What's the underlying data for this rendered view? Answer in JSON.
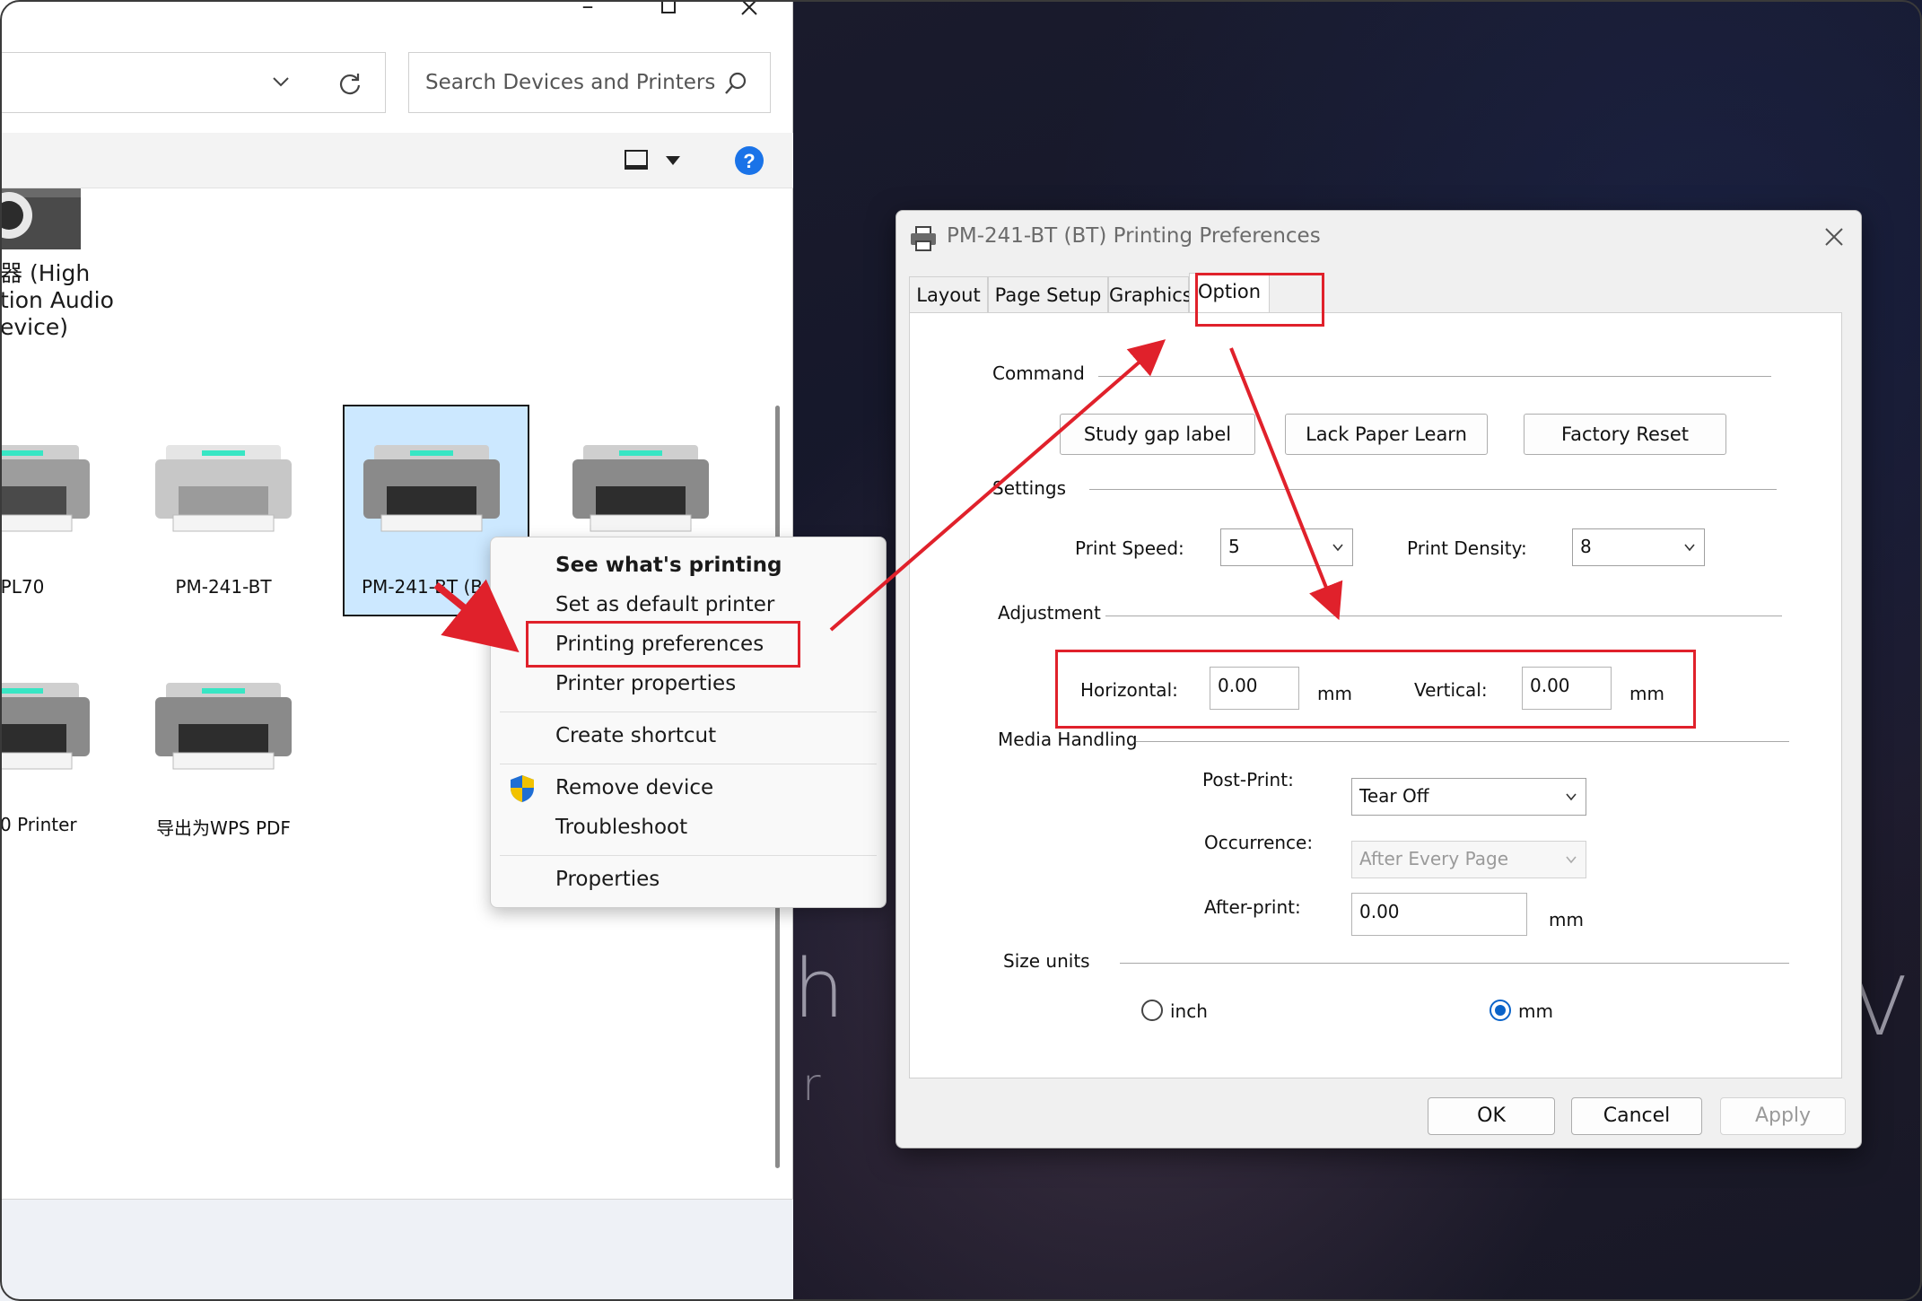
{
  "explorer": {
    "search_placeholder": "Search Devices and Printers",
    "devices_top": {
      "audio_label_line1": "器 (High",
      "audio_label_line2": "tion Audio",
      "audio_label_line3": "evice)"
    },
    "printers_row1": [
      "PL70",
      "PM-241-BT",
      "PM-241-BT (B",
      ""
    ],
    "printers_row2": [
      "0 Printer",
      "导出为WPS PDF"
    ]
  },
  "context_menu": {
    "items": [
      "See what's printing",
      "Set as default printer",
      "Printing preferences",
      "Printer properties",
      "Create shortcut",
      "Remove device",
      "Troubleshoot",
      "Properties"
    ]
  },
  "dialog": {
    "title": "PM-241-BT (BT) Printing Preferences",
    "tabs": [
      "Layout",
      "Page Setup",
      "Graphics",
      "Option"
    ],
    "active_tab": "Option",
    "command": {
      "label": "Command",
      "buttons": [
        "Study gap label",
        "Lack Paper Learn",
        "Factory Reset"
      ]
    },
    "settings": {
      "label": "Settings",
      "print_speed_label": "Print Speed:",
      "print_speed_value": "5",
      "print_density_label": "Print Density:",
      "print_density_value": "8"
    },
    "adjustment": {
      "label": "Adjustment",
      "horizontal_label": "Horizontal:",
      "horizontal_value": "0.00",
      "vertical_label": "Vertical:",
      "vertical_value": "0.00",
      "unit": "mm"
    },
    "media_handling": {
      "label": "Media Handling",
      "post_print_label": "Post-Print:",
      "post_print_value": "Tear Off",
      "occurrence_label": "Occurrence:",
      "occurrence_value": "After Every Page",
      "after_print_label": "After-print:",
      "after_print_value": "0.00",
      "unit": "mm"
    },
    "size_units": {
      "label": "Size units",
      "options": [
        "inch",
        "mm"
      ],
      "selected": "mm"
    },
    "footer": {
      "ok": "OK",
      "cancel": "Cancel",
      "apply": "Apply"
    }
  },
  "colors": {
    "annotation_red": "#e0212b",
    "selection_blue": "#cce8ff",
    "radio_blue": "#0a63c9",
    "help_blue": "#1a73e8"
  }
}
